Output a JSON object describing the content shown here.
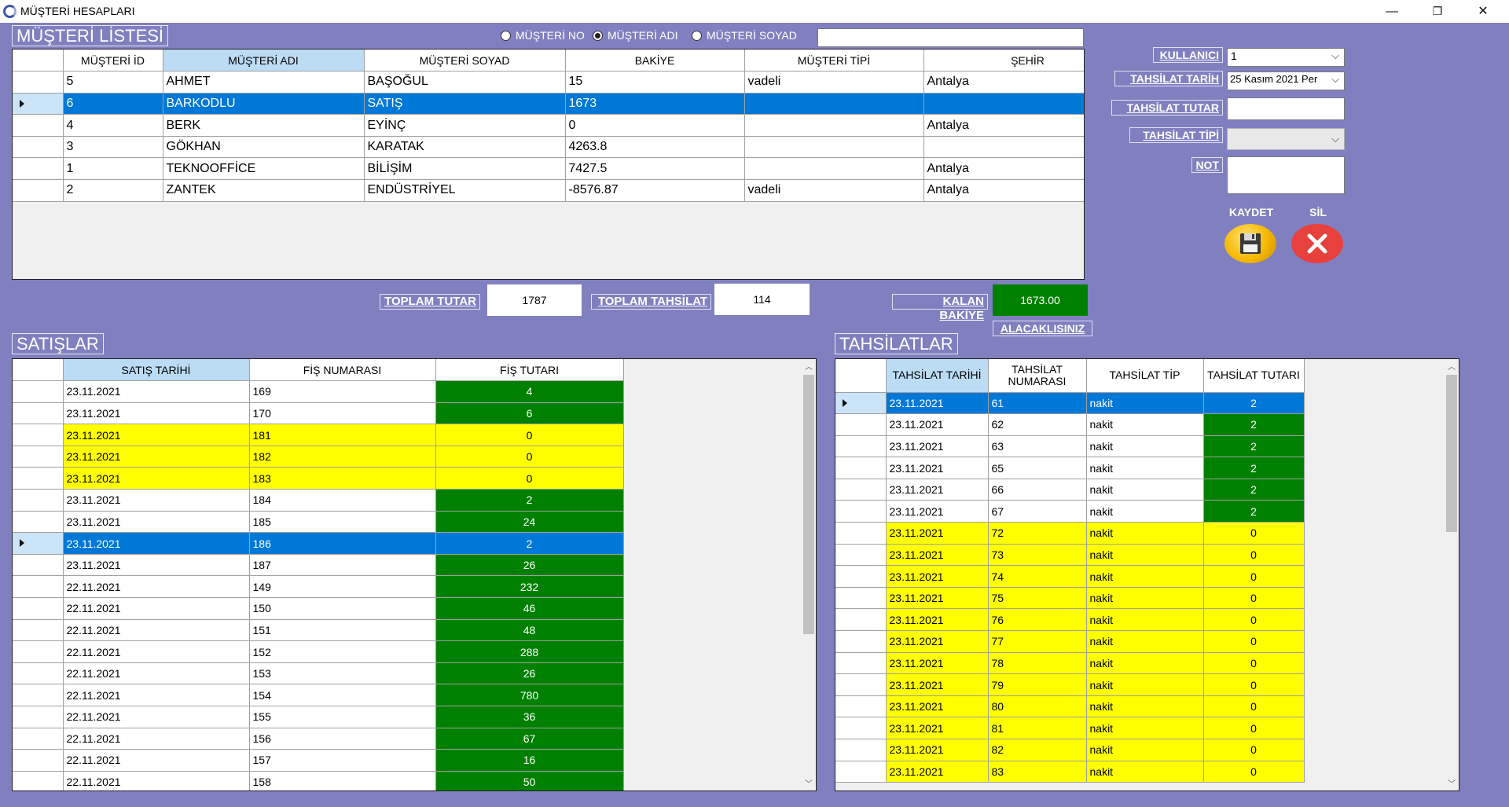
{
  "window": {
    "title": "MÜŞTERİ HESAPLARI",
    "minimize": "—",
    "restore": "❐",
    "close": "✕"
  },
  "customers": {
    "section_title": "MÜŞTERİ LİSTESİ",
    "search": {
      "options": [
        "MÜŞTERİ NO",
        "MÜŞTERİ ADI",
        "MÜŞTERİ SOYAD"
      ],
      "selected": "MÜŞTERİ ADI",
      "value": ""
    },
    "columns": [
      "MÜŞTERİ İD",
      "MÜŞTERİ ADI",
      "MÜŞTERİ SOYAD",
      "BAKİYE",
      "MÜŞTERİ TİPİ",
      "ŞEHİR"
    ],
    "rows": [
      [
        "5",
        "AHMET",
        "BAŞOĞUL",
        "15",
        "vadeli",
        "Antalya"
      ],
      [
        "6",
        "BARKODLU",
        "SATIŞ",
        "1673",
        "",
        ""
      ],
      [
        "4",
        "BERK",
        "EYİNÇ",
        "0",
        "",
        "Antalya"
      ],
      [
        "3",
        "GÖKHAN",
        "KARATAK",
        "4263.8",
        "",
        ""
      ],
      [
        "1",
        "TEKNOOFFİCE",
        "BİLİŞİM",
        "7427.5",
        "",
        "Antalya"
      ],
      [
        "2",
        "ZANTEK",
        "ENDÜSTRİYEL",
        "-8576.87",
        "vadeli",
        "Antalya"
      ]
    ],
    "selected_row": 1
  },
  "form": {
    "kullanici_label": "KULLANICI",
    "kullanici_value": "1",
    "tarih_label": "TAHSİLAT TARİH",
    "tarih_value": "25   Kasım   2021 Per",
    "tutar_label": "TAHSİLAT TUTAR",
    "tutar_value": "",
    "tip_label": "TAHSİLAT TİPİ",
    "tip_value": "",
    "not_label": "NOT",
    "not_value": "",
    "save_label": "KAYDET",
    "delete_label": "SİL"
  },
  "totals": {
    "toplam_tutar_label": "TOPLAM TUTAR",
    "toplam_tutar": "1787",
    "toplam_tahsilat_label": "TOPLAM TAHSİLAT",
    "toplam_tahsilat": "114",
    "kalan_bakiye_label": "KALAN BAKİYE",
    "kalan_bakiye": "1673.00",
    "status": "ALACAKLISINIZ"
  },
  "sales": {
    "section_title": "SATIŞLAR",
    "columns": [
      "SATIŞ TARİHİ",
      "FİŞ NUMARASI",
      "FİŞ TUTARI"
    ],
    "rows": [
      [
        "23.11.2021",
        "169",
        "4"
      ],
      [
        "23.11.2021",
        "170",
        "6"
      ],
      [
        "23.11.2021",
        "181",
        "0"
      ],
      [
        "23.11.2021",
        "182",
        "0"
      ],
      [
        "23.11.2021",
        "183",
        "0"
      ],
      [
        "23.11.2021",
        "184",
        "2"
      ],
      [
        "23.11.2021",
        "185",
        "24"
      ],
      [
        "23.11.2021",
        "186",
        "2"
      ],
      [
        "23.11.2021",
        "187",
        "26"
      ],
      [
        "22.11.2021",
        "149",
        "232"
      ],
      [
        "22.11.2021",
        "150",
        "46"
      ],
      [
        "22.11.2021",
        "151",
        "48"
      ],
      [
        "22.11.2021",
        "152",
        "288"
      ],
      [
        "22.11.2021",
        "153",
        "26"
      ],
      [
        "22.11.2021",
        "154",
        "780"
      ],
      [
        "22.11.2021",
        "155",
        "36"
      ],
      [
        "22.11.2021",
        "156",
        "67"
      ],
      [
        "22.11.2021",
        "157",
        "16"
      ],
      [
        "22.11.2021",
        "158",
        "50"
      ]
    ],
    "selected_row": 7
  },
  "collections": {
    "section_title": "TAHSİLATLAR",
    "columns": [
      "TAHSİLAT TARİHİ",
      "TAHSİLAT NUMARASI",
      "TAHSİLAT TİP",
      "TAHSİLAT TUTARI"
    ],
    "rows": [
      [
        "23.11.2021",
        "61",
        "nakit",
        "2"
      ],
      [
        "23.11.2021",
        "62",
        "nakit",
        "2"
      ],
      [
        "23.11.2021",
        "63",
        "nakit",
        "2"
      ],
      [
        "23.11.2021",
        "65",
        "nakit",
        "2"
      ],
      [
        "23.11.2021",
        "66",
        "nakit",
        "2"
      ],
      [
        "23.11.2021",
        "67",
        "nakit",
        "2"
      ],
      [
        "23.11.2021",
        "72",
        "nakit",
        "0"
      ],
      [
        "23.11.2021",
        "73",
        "nakit",
        "0"
      ],
      [
        "23.11.2021",
        "74",
        "nakit",
        "0"
      ],
      [
        "23.11.2021",
        "75",
        "nakit",
        "0"
      ],
      [
        "23.11.2021",
        "76",
        "nakit",
        "0"
      ],
      [
        "23.11.2021",
        "77",
        "nakit",
        "0"
      ],
      [
        "23.11.2021",
        "78",
        "nakit",
        "0"
      ],
      [
        "23.11.2021",
        "79",
        "nakit",
        "0"
      ],
      [
        "23.11.2021",
        "80",
        "nakit",
        "0"
      ],
      [
        "23.11.2021",
        "81",
        "nakit",
        "0"
      ],
      [
        "23.11.2021",
        "82",
        "nakit",
        "0"
      ],
      [
        "23.11.2021",
        "83",
        "nakit",
        "0"
      ]
    ],
    "selected_row": 0
  },
  "colors": {
    "window_bg": "#8080c0",
    "selection": "#0078d7",
    "zero_row": "#ffff00",
    "amount_cell": "#008000"
  }
}
